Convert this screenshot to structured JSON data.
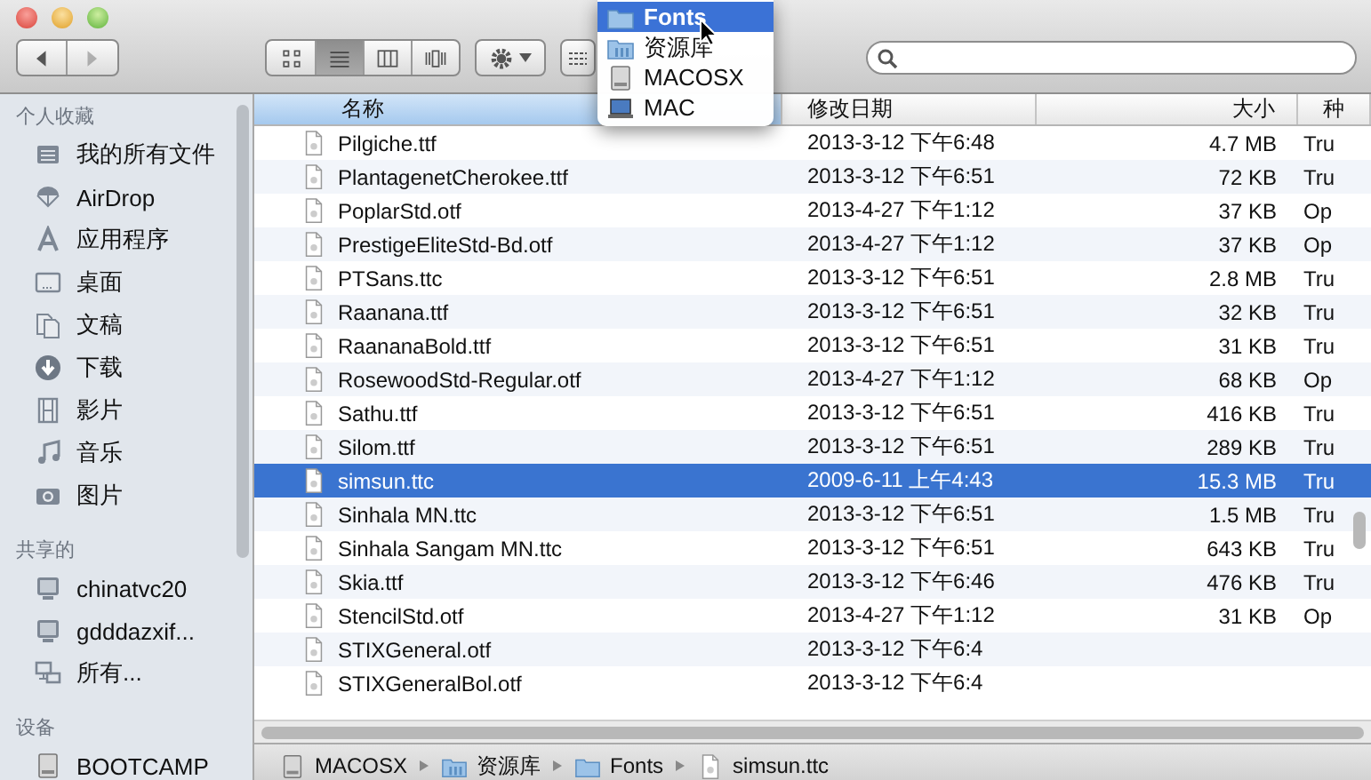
{
  "toolbar": {
    "nav": [
      {
        "kind": "back",
        "disabled": false
      },
      {
        "kind": "forward",
        "disabled": true
      }
    ],
    "views": [
      {
        "kind": "icons",
        "selected": false
      },
      {
        "kind": "list",
        "selected": true
      },
      {
        "kind": "columns",
        "selected": false
      },
      {
        "kind": "coverflow",
        "selected": false
      }
    ]
  },
  "path_menu": {
    "items": [
      {
        "label": "Fonts",
        "kind": "folder",
        "selected": true
      },
      {
        "label": "资源库",
        "kind": "library",
        "selected": false
      },
      {
        "label": "MACOSX",
        "kind": "disk",
        "selected": false
      },
      {
        "label": "MAC",
        "kind": "computer",
        "selected": false
      }
    ]
  },
  "sidebar": {
    "sections": [
      {
        "title": "个人收藏",
        "items": [
          {
            "label": "我的所有文件",
            "kind": "allfiles"
          },
          {
            "label": "AirDrop",
            "kind": "airdrop"
          },
          {
            "label": "应用程序",
            "kind": "apps"
          },
          {
            "label": "桌面",
            "kind": "desktop"
          },
          {
            "label": "文稿",
            "kind": "docs"
          },
          {
            "label": "下载",
            "kind": "download"
          },
          {
            "label": "影片",
            "kind": "movies"
          },
          {
            "label": "音乐",
            "kind": "music"
          },
          {
            "label": "图片",
            "kind": "camera"
          }
        ]
      },
      {
        "title": "共享的",
        "items": [
          {
            "label": "chinatvc20",
            "kind": "monitor"
          },
          {
            "label": "gdddazxif...",
            "kind": "monitor"
          },
          {
            "label": "所有...",
            "kind": "network"
          }
        ]
      },
      {
        "title": "设备",
        "items": [
          {
            "label": "BOOTCAMP",
            "kind": "disk"
          }
        ]
      }
    ]
  },
  "table": {
    "columns": [
      {
        "label": "名称",
        "sorted": true
      },
      {
        "label": "修改日期",
        "sorted": false
      },
      {
        "label": "大小",
        "sorted": false
      },
      {
        "label": "种",
        "sorted": false
      }
    ],
    "rows": [
      {
        "name": "Pilgiche.ttf",
        "modified": "2013-3-12 下午6:48",
        "size": "4.7 MB",
        "kind": "Tru",
        "selected": false
      },
      {
        "name": "PlantagenetCherokee.ttf",
        "modified": "2013-3-12 下午6:51",
        "size": "72 KB",
        "kind": "Tru",
        "selected": false
      },
      {
        "name": "PoplarStd.otf",
        "modified": "2013-4-27 下午1:12",
        "size": "37 KB",
        "kind": "Op",
        "selected": false
      },
      {
        "name": "PrestigeEliteStd-Bd.otf",
        "modified": "2013-4-27 下午1:12",
        "size": "37 KB",
        "kind": "Op",
        "selected": false
      },
      {
        "name": "PTSans.ttc",
        "modified": "2013-3-12 下午6:51",
        "size": "2.8 MB",
        "kind": "Tru",
        "selected": false
      },
      {
        "name": "Raanana.ttf",
        "modified": "2013-3-12 下午6:51",
        "size": "32 KB",
        "kind": "Tru",
        "selected": false
      },
      {
        "name": "RaananaBold.ttf",
        "modified": "2013-3-12 下午6:51",
        "size": "31 KB",
        "kind": "Tru",
        "selected": false
      },
      {
        "name": "RosewoodStd-Regular.otf",
        "modified": "2013-4-27 下午1:12",
        "size": "68 KB",
        "kind": "Op",
        "selected": false
      },
      {
        "name": "Sathu.ttf",
        "modified": "2013-3-12 下午6:51",
        "size": "416 KB",
        "kind": "Tru",
        "selected": false
      },
      {
        "name": "Silom.ttf",
        "modified": "2013-3-12 下午6:51",
        "size": "289 KB",
        "kind": "Tru",
        "selected": false
      },
      {
        "name": "simsun.ttc",
        "modified": "2009-6-11 上午4:43",
        "size": "15.3 MB",
        "kind": "Tru",
        "selected": true
      },
      {
        "name": "Sinhala MN.ttc",
        "modified": "2013-3-12 下午6:51",
        "size": "1.5 MB",
        "kind": "Tru",
        "selected": false
      },
      {
        "name": "Sinhala Sangam MN.ttc",
        "modified": "2013-3-12 下午6:51",
        "size": "643 KB",
        "kind": "Tru",
        "selected": false
      },
      {
        "name": "Skia.ttf",
        "modified": "2013-3-12 下午6:46",
        "size": "476 KB",
        "kind": "Tru",
        "selected": false
      },
      {
        "name": "StencilStd.otf",
        "modified": "2013-4-27 下午1:12",
        "size": "31 KB",
        "kind": "Op",
        "selected": false
      },
      {
        "name": "STIXGeneral.otf",
        "modified": "2013-3-12 下午6:4",
        "selected": false
      },
      {
        "name": "STIXGeneralBol.otf",
        "modified": "2013-3-12 下午6:4",
        "selected": false
      }
    ]
  },
  "path_bar": [
    {
      "label": "MACOSX",
      "kind": "disk"
    },
    {
      "label": "资源库",
      "kind": "library"
    },
    {
      "label": "Fonts",
      "kind": "folder"
    },
    {
      "label": "simsun.ttc",
      "kind": "file"
    }
  ]
}
